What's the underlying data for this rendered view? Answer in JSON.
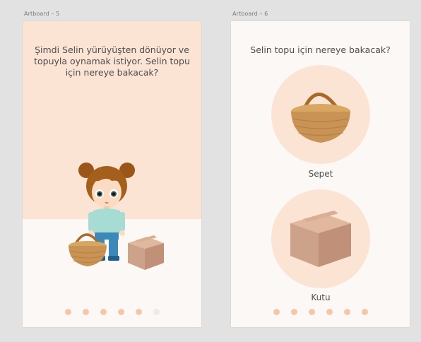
{
  "artboards": [
    {
      "label": "Artboard – 5",
      "question": "Şimdi Selin yürüyüşten dönüyor ve topuyla oynamak istiyor. Selin topu için nereye bakacak?",
      "dots": {
        "count": 6,
        "active": 5
      }
    },
    {
      "label": "Artboard – 6",
      "question": "Selin topu için nereye bakacak?",
      "options": [
        {
          "label": "Sepet",
          "icon": "basket-icon"
        },
        {
          "label": "Kutu",
          "icon": "box-icon"
        }
      ],
      "dots": {
        "count": 6,
        "active": 6
      }
    }
  ],
  "colors": {
    "peach": "#fbe4d4",
    "dot_active": "#f6c6a7",
    "dot_inactive": "#ebebeb",
    "background": "#e2e2e2",
    "text": "#4e4e4e"
  }
}
